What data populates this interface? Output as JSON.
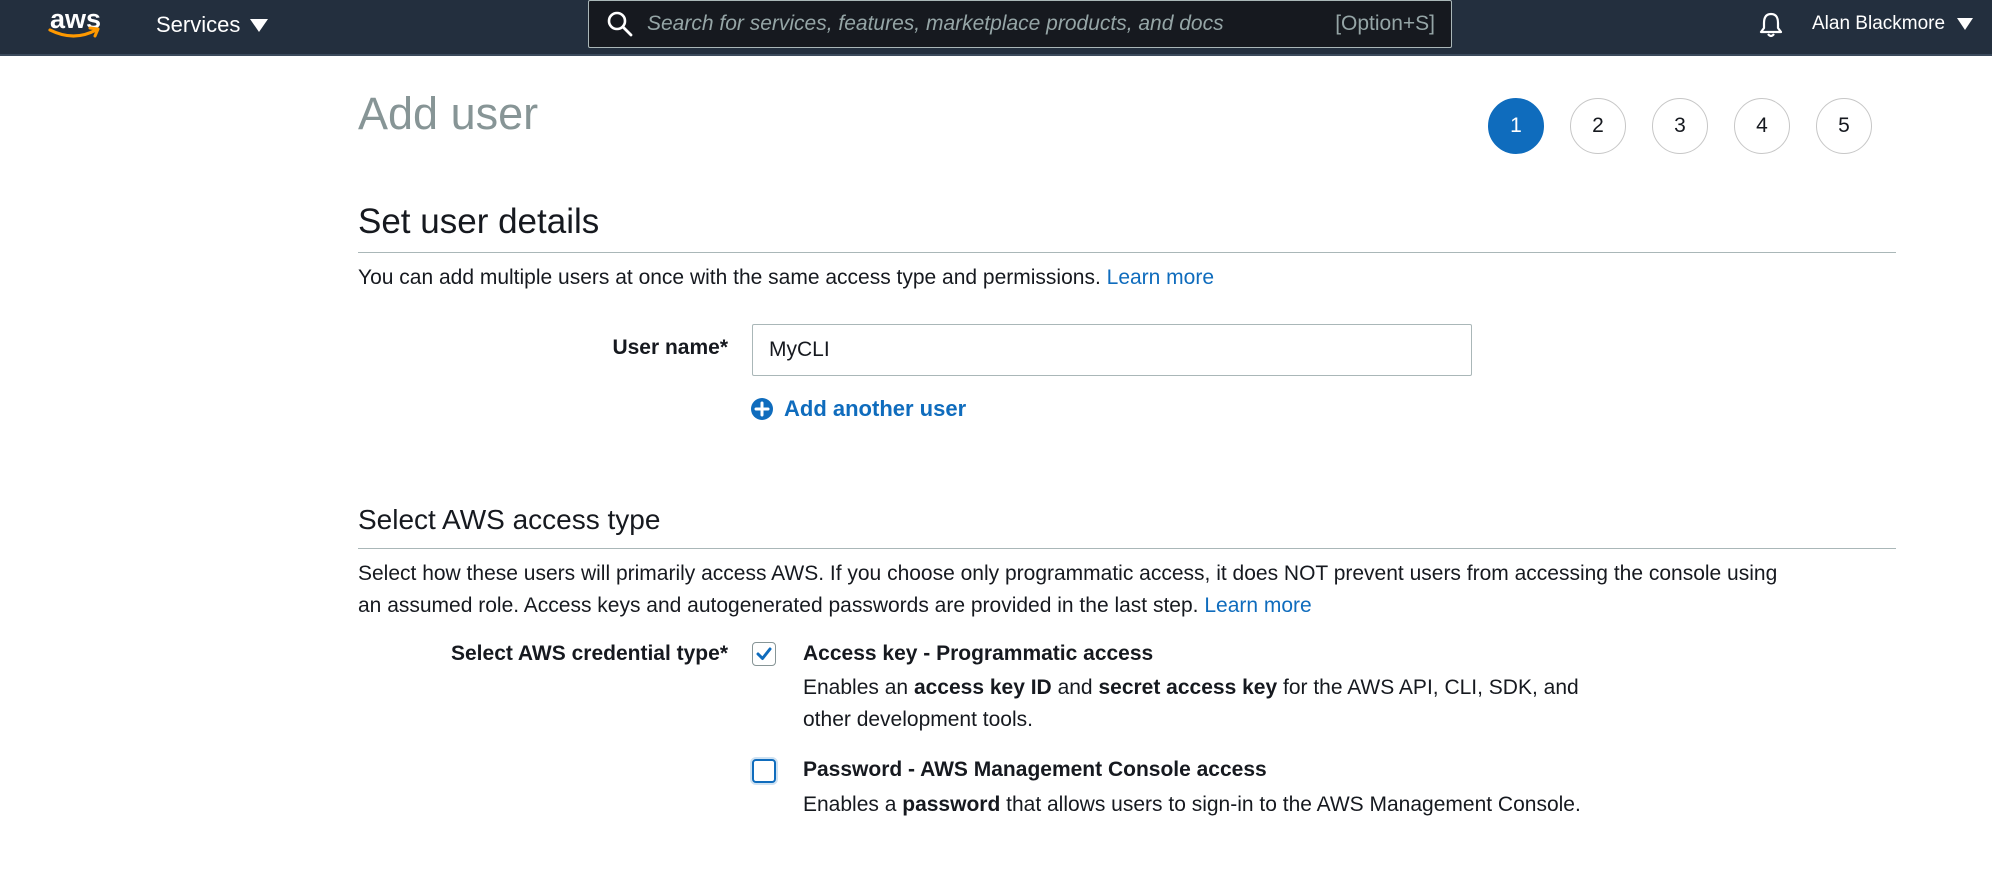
{
  "nav": {
    "logo_text": "aws",
    "services_label": "Services",
    "search_placeholder": "Search for services, features, marketplace products, and docs",
    "search_shortcut": "[Option+S]",
    "account_name": "Alan Blackmore"
  },
  "page": {
    "title": "Add user",
    "steps": [
      "1",
      "2",
      "3",
      "4",
      "5"
    ],
    "active_step": 1
  },
  "user_details": {
    "title": "Set user details",
    "description": "You can add multiple users at once with the same access type and permissions.",
    "learn_more": "Learn more",
    "user_name_label": "User name*",
    "user_name_value": "MyCLI",
    "add_another_label": "Add another user"
  },
  "access_type": {
    "title": "Select AWS access type",
    "description_line1": "Select how these users will primarily access AWS. If you choose only programmatic access, it does NOT prevent users from accessing the console using",
    "description_line2": "an assumed role. Access keys and autogenerated passwords are provided in the last step.",
    "learn_more": "Learn more",
    "credential_label": "Select AWS credential type*",
    "options": [
      {
        "title": "Access key - Programmatic access",
        "checked": true,
        "desc_pre": "Enables an",
        "desc_b1": "access key ID",
        "desc_mid": "and",
        "desc_b2": "secret access key",
        "desc_post": "for the AWS API, CLI, SDK, and",
        "desc_line2": "other development tools."
      },
      {
        "title": "Password - AWS Management Console access",
        "checked": false,
        "desc_pre": "Enables a",
        "desc_b1": "password",
        "desc_post": "that allows users to sign-in to the AWS Management Console."
      }
    ]
  },
  "colors": {
    "nav_bg": "#232f3e",
    "link": "#0f6cbd",
    "active_step": "#0f6cbd",
    "title_grey": "#879596"
  }
}
